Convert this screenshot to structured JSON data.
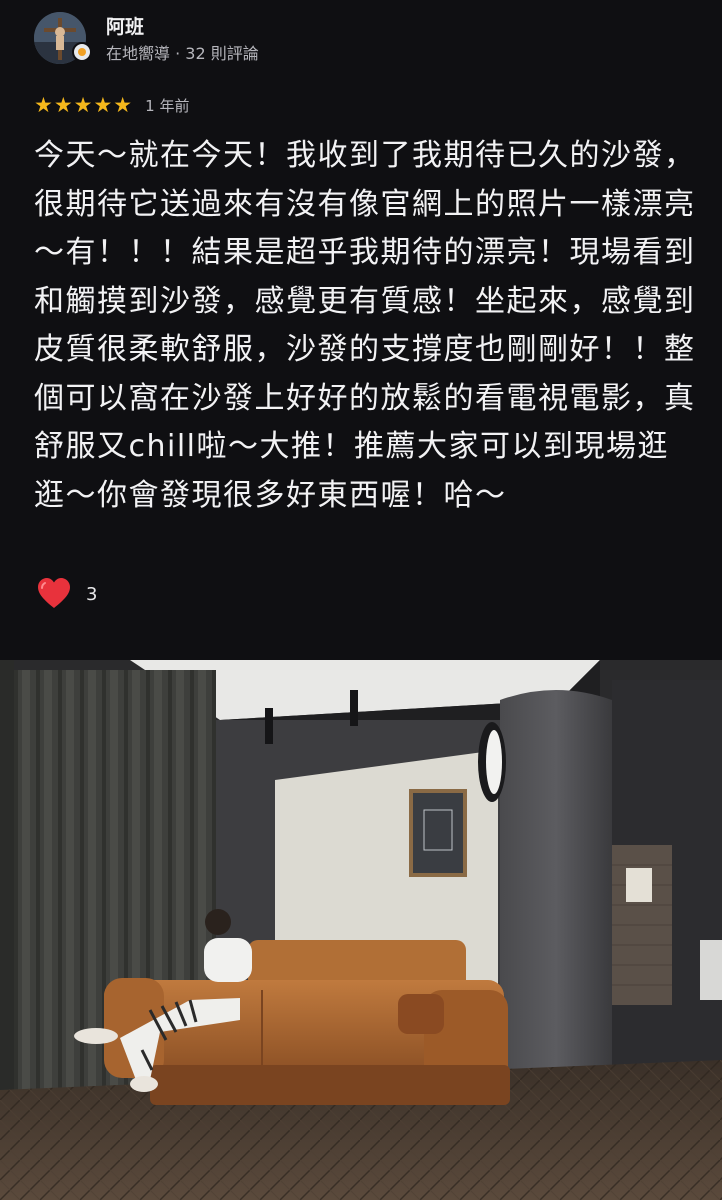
{
  "reviewer": {
    "name": "阿班",
    "meta": "在地嚮導 · 32 則評論"
  },
  "rating": {
    "stars": 5,
    "stars_text": "★★★★★",
    "time": "1 年前",
    "star_color": "#f5b81c"
  },
  "review": {
    "text": "今天～就在今天！我收到了我期待已久的沙發，很期待它送過來有沒有像官網上的照片一樣漂亮～有！！！結果是超乎我期待的漂亮！現場看到和觸摸到沙發，感覺更有質感！坐起來，感覺到皮質很柔軟舒服，沙發的支撐度也剛剛好！！整個可以窩在沙發上好好的放鬆的看電視電影，真舒服又chill啦～大推！推薦大家可以到現場逛逛～你會發現很多好東西喔！哈～"
  },
  "reactions": {
    "icon": "heart-icon",
    "count": "3"
  },
  "photo": {
    "icon": "review-photo"
  }
}
